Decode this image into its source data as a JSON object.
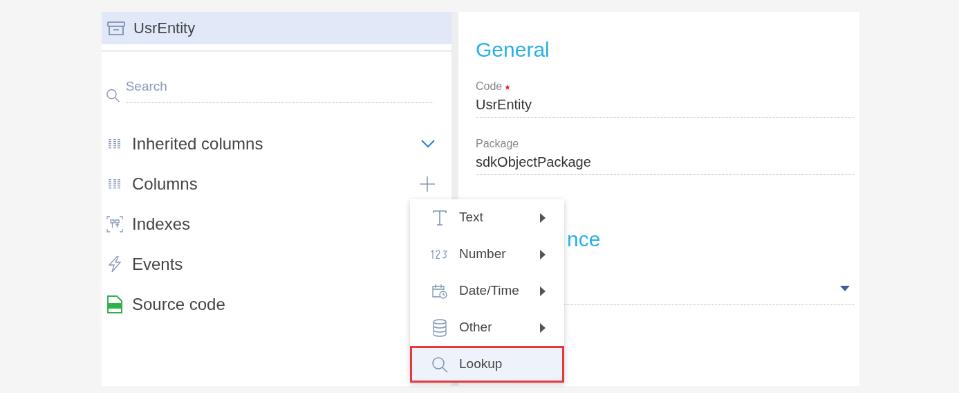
{
  "header": {
    "title": "UsrEntity",
    "selected": true
  },
  "search": {
    "placeholder": "Search"
  },
  "sections": [
    {
      "label": "Inherited columns"
    },
    {
      "label": "Columns"
    },
    {
      "label": "Indexes"
    },
    {
      "label": "Events"
    },
    {
      "label": "Source code"
    }
  ],
  "general": {
    "heading": "General",
    "fields": [
      {
        "label": "Code",
        "required": true,
        "value": "UsrEntity"
      },
      {
        "label": "Package",
        "required": false,
        "value": "sdkObjectPackage"
      }
    ]
  },
  "second_heading": "nce",
  "menu": [
    {
      "label": "Text",
      "submenu": true,
      "selected": false
    },
    {
      "label": "Number",
      "submenu": true,
      "selected": false
    },
    {
      "label": "Date/Time",
      "submenu": true,
      "selected": false
    },
    {
      "label": "Other",
      "submenu": true,
      "selected": false
    },
    {
      "label": "Lookup",
      "submenu": false,
      "selected": true
    }
  ]
}
